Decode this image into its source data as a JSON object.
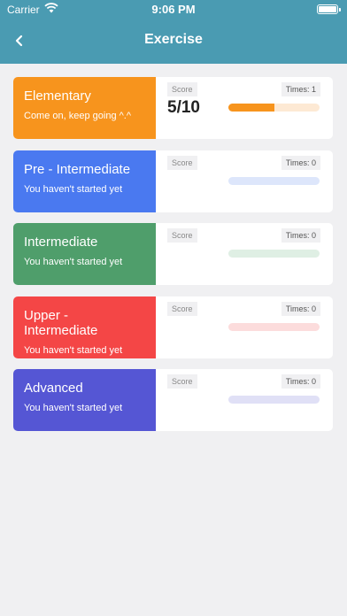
{
  "status": {
    "carrier": "Carrier",
    "time": "9:06 PM"
  },
  "header": {
    "title": "Exercise",
    "back_icon": "chevron-left-icon"
  },
  "levels": [
    {
      "name": "Elementary",
      "subtitle": "Come on, keep going ^.^",
      "score_label": "Score",
      "score": "5/10",
      "times": "Times: 1",
      "progress": 0.5,
      "color": "#f7941d",
      "track": "#fde9d4"
    },
    {
      "name": "Pre - Intermediate",
      "subtitle": "You haven't started yet",
      "score_label": "Score",
      "score": "",
      "times": "Times: 0",
      "progress": 0,
      "color": "#4a79f0",
      "track": "#dde6fb"
    },
    {
      "name": "Intermediate",
      "subtitle": "You haven't started yet",
      "score_label": "Score",
      "score": "",
      "times": "Times: 0",
      "progress": 0,
      "color": "#4f9e6b",
      "track": "#dfefe4"
    },
    {
      "name": "Upper - Intermediate",
      "subtitle": "You haven't started yet",
      "score_label": "Score",
      "score": "",
      "times": "Times: 0",
      "progress": 0,
      "color": "#f44646",
      "track": "#fcdcdc"
    },
    {
      "name": "Advanced",
      "subtitle": "You haven't started yet",
      "score_label": "Score",
      "score": "",
      "times": "Times: 0",
      "progress": 0,
      "color": "#5556d4",
      "track": "#e0e0f6"
    }
  ]
}
